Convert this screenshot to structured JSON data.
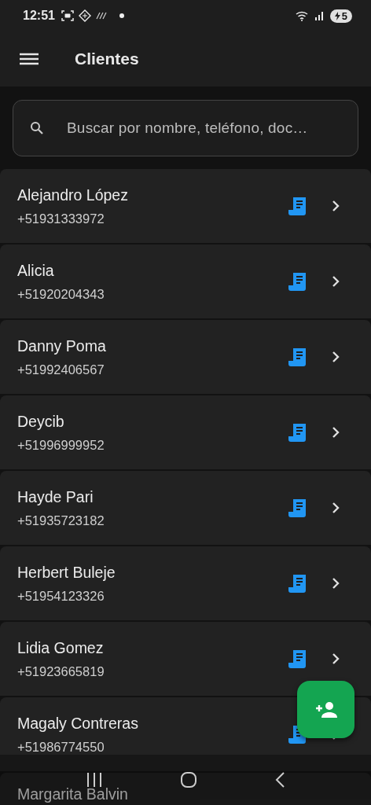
{
  "status_bar": {
    "time": "12:51",
    "battery": "5"
  },
  "app_bar": {
    "title": "Clientes"
  },
  "search": {
    "placeholder": "Buscar por nombre, teléfono, doc…"
  },
  "clients": [
    {
      "name": "Alejandro López",
      "phone": "+51931333972"
    },
    {
      "name": "Alicia",
      "phone": "+51920204343"
    },
    {
      "name": "Danny Poma",
      "phone": "+51992406567"
    },
    {
      "name": "Deycib",
      "phone": "+51996999952"
    },
    {
      "name": "Hayde Pari",
      "phone": "+51935723182"
    },
    {
      "name": "Herbert Buleje",
      "phone": "+51954123326"
    },
    {
      "name": "Lidia Gomez",
      "phone": "+51923665819"
    },
    {
      "name": "Magaly Contreras",
      "phone": "+51986774550"
    },
    {
      "name": "Margarita Balvin"
    }
  ]
}
